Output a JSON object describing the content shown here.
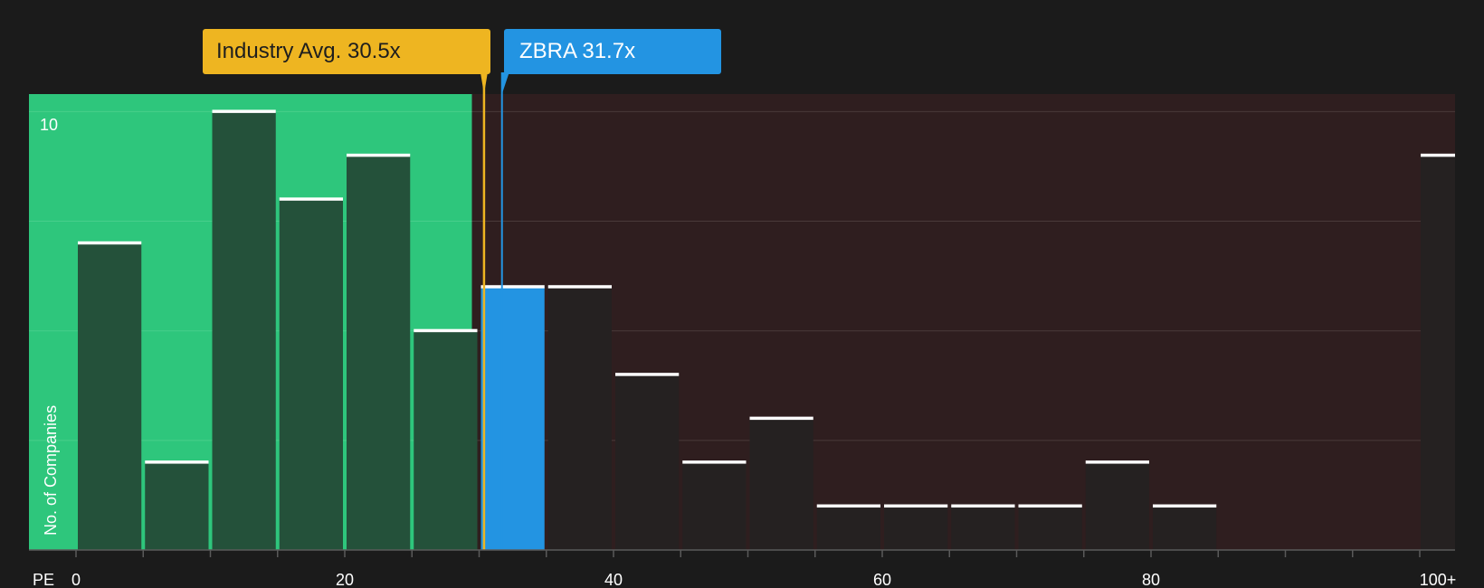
{
  "chart_data": {
    "type": "bar",
    "x_axis_label": "PE",
    "y_axis_label": "No. of Companies",
    "x_ticks": [
      "0",
      "20",
      "40",
      "60",
      "80",
      "100+"
    ],
    "x_tick_values": [
      0,
      20,
      40,
      60,
      80,
      100
    ],
    "y_tick_label": "10",
    "y_tick_value": 10,
    "ylim": [
      0,
      10.4
    ],
    "bin_width": 5,
    "bins": [
      {
        "start": 0,
        "count": 7
      },
      {
        "start": 5,
        "count": 2
      },
      {
        "start": 10,
        "count": 10
      },
      {
        "start": 15,
        "count": 8
      },
      {
        "start": 20,
        "count": 9
      },
      {
        "start": 25,
        "count": 5
      },
      {
        "start": 30,
        "count": 6,
        "highlight": true
      },
      {
        "start": 35,
        "count": 6
      },
      {
        "start": 40,
        "count": 4
      },
      {
        "start": 45,
        "count": 2
      },
      {
        "start": 50,
        "count": 3
      },
      {
        "start": 55,
        "count": 1
      },
      {
        "start": 60,
        "count": 1
      },
      {
        "start": 65,
        "count": 1
      },
      {
        "start": 70,
        "count": 1
      },
      {
        "start": 75,
        "count": 2
      },
      {
        "start": 80,
        "count": 1
      },
      {
        "start": 85,
        "count": 0
      },
      {
        "start": 90,
        "count": 0
      },
      {
        "start": 95,
        "count": 0
      },
      {
        "start": 100,
        "count": 9,
        "overflow": true
      }
    ],
    "industry_average": {
      "label": "Industry Avg. 30.5x",
      "value": 30.5
    },
    "company": {
      "label": "ZBRA 31.7x",
      "value": 31.7
    },
    "colors": {
      "background": "#1b1b1b",
      "below_region": "#2ec67c",
      "above_region": "#2f1e1f",
      "bar_below": "#24513a",
      "bar_above": "#252121",
      "bar_company": "#2394e2",
      "industry": "#eeb521",
      "company": "#2394e2",
      "bar_cap": "#ffffff",
      "axis": "#5a5a5a"
    }
  }
}
